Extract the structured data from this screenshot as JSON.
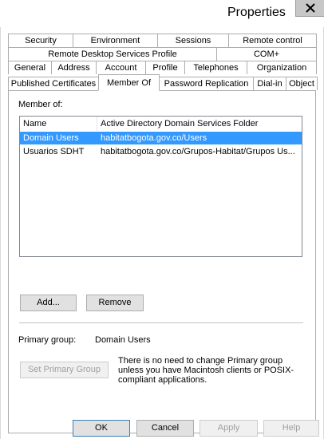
{
  "window": {
    "title": "Properties",
    "close_glyph": "X"
  },
  "tabs": {
    "row1": [
      "Security",
      "Environment",
      "Sessions",
      "Remote control"
    ],
    "row2": [
      "Remote Desktop Services Profile",
      "COM+"
    ],
    "row3": [
      "General",
      "Address",
      "Account",
      "Profile",
      "Telephones",
      "Organization"
    ],
    "row4": [
      "Published Certificates",
      "Member Of",
      "Password Replication",
      "Dial-in",
      "Object"
    ],
    "active": "Member Of"
  },
  "member_of": {
    "label": "Member of:",
    "columns": [
      "Name",
      "Active Directory Domain Services Folder"
    ],
    "rows": [
      {
        "name": "Domain Users",
        "folder": "habitatbogota.gov.co/Users",
        "selected": true
      },
      {
        "name": "Usuarios SDHT",
        "folder": "habitatbogota.gov.co/Grupos-Habitat/Grupos Us...",
        "selected": false
      }
    ],
    "add_label": "Add...",
    "remove_label": "Remove"
  },
  "primary_group": {
    "label": "Primary group:",
    "value": "Domain Users",
    "set_button_label": "Set Primary Group",
    "note": "There is no need to change Primary group unless you have Macintosh clients or POSIX-compliant applications."
  },
  "footer": {
    "ok_label": "OK",
    "cancel_label": "Cancel",
    "apply_label": "Apply",
    "help_label": "Help"
  },
  "colors": {
    "selection": "#3399ff",
    "close_button": "#c7c7c7"
  }
}
